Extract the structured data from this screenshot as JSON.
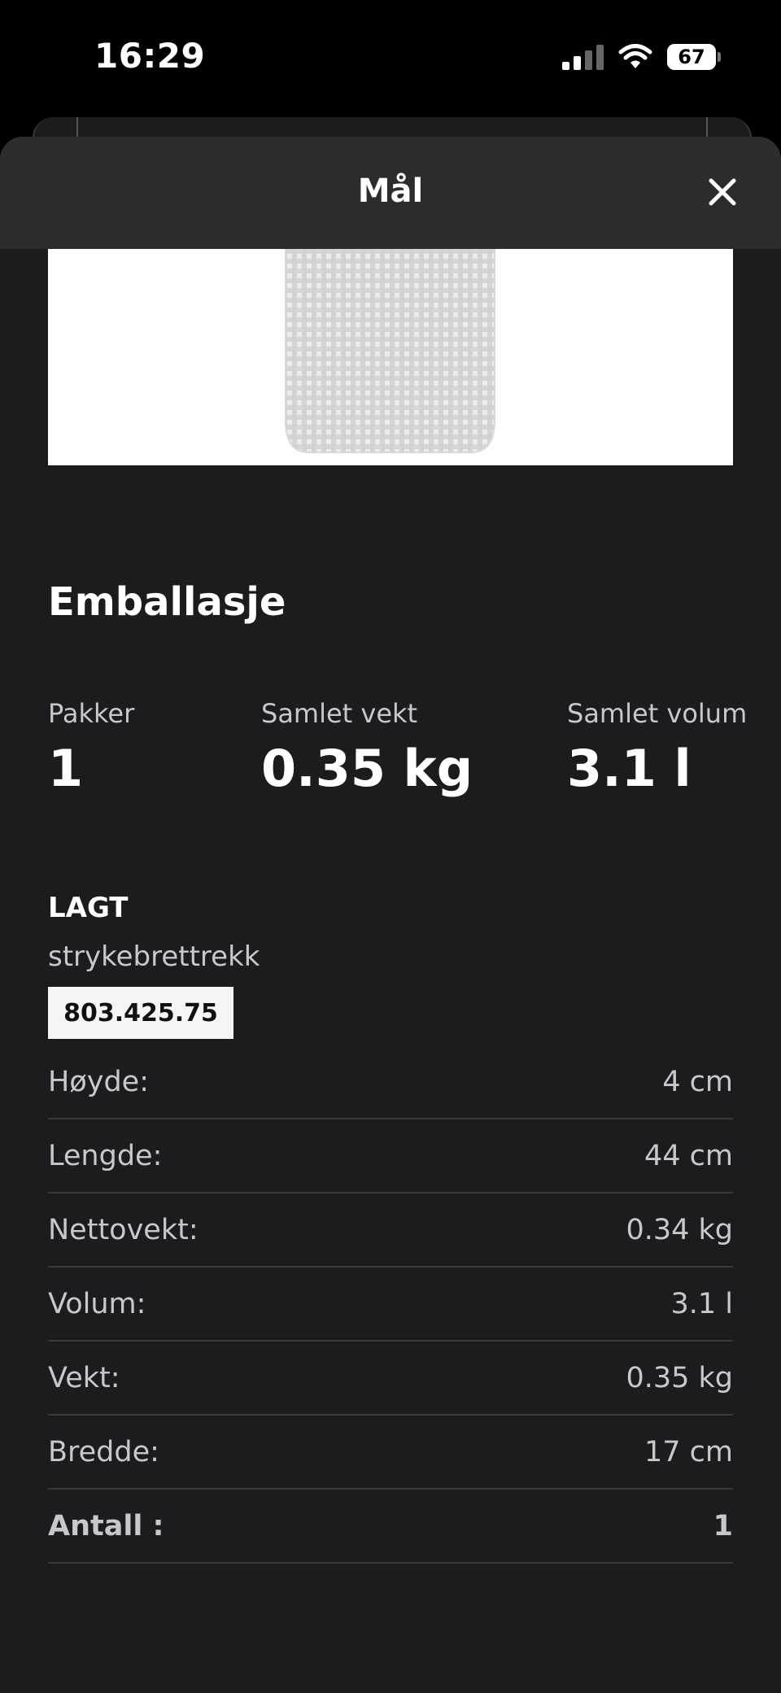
{
  "status_bar": {
    "time": "16:29",
    "battery": "67"
  },
  "sheet": {
    "title": "Mål"
  },
  "packaging": {
    "heading": "Emballasje",
    "stats": [
      {
        "label": "Pakker",
        "value": "1"
      },
      {
        "label": "Samlet vekt",
        "value": "0.35 kg"
      },
      {
        "label": "Samlet volum",
        "value": "3.1 l"
      }
    ],
    "part": {
      "name": "LAGT",
      "description": "strykebrettrekk",
      "article_number": "803.425.75"
    },
    "specs": [
      {
        "label": "Høyde:",
        "value": "4 cm"
      },
      {
        "label": "Lengde:",
        "value": "44 cm"
      },
      {
        "label": "Nettovekt:",
        "value": "0.34 kg"
      },
      {
        "label": "Volum:",
        "value": "3.1 l"
      },
      {
        "label": "Vekt:",
        "value": "0.35 kg"
      },
      {
        "label": "Bredde:",
        "value": "17 cm"
      }
    ],
    "quantity": {
      "label": "Antall :",
      "value": "1"
    }
  },
  "colors": {
    "background": "#1c1c1e",
    "header": "#2c2c2e",
    "text_muted": "#c7c7cc"
  }
}
